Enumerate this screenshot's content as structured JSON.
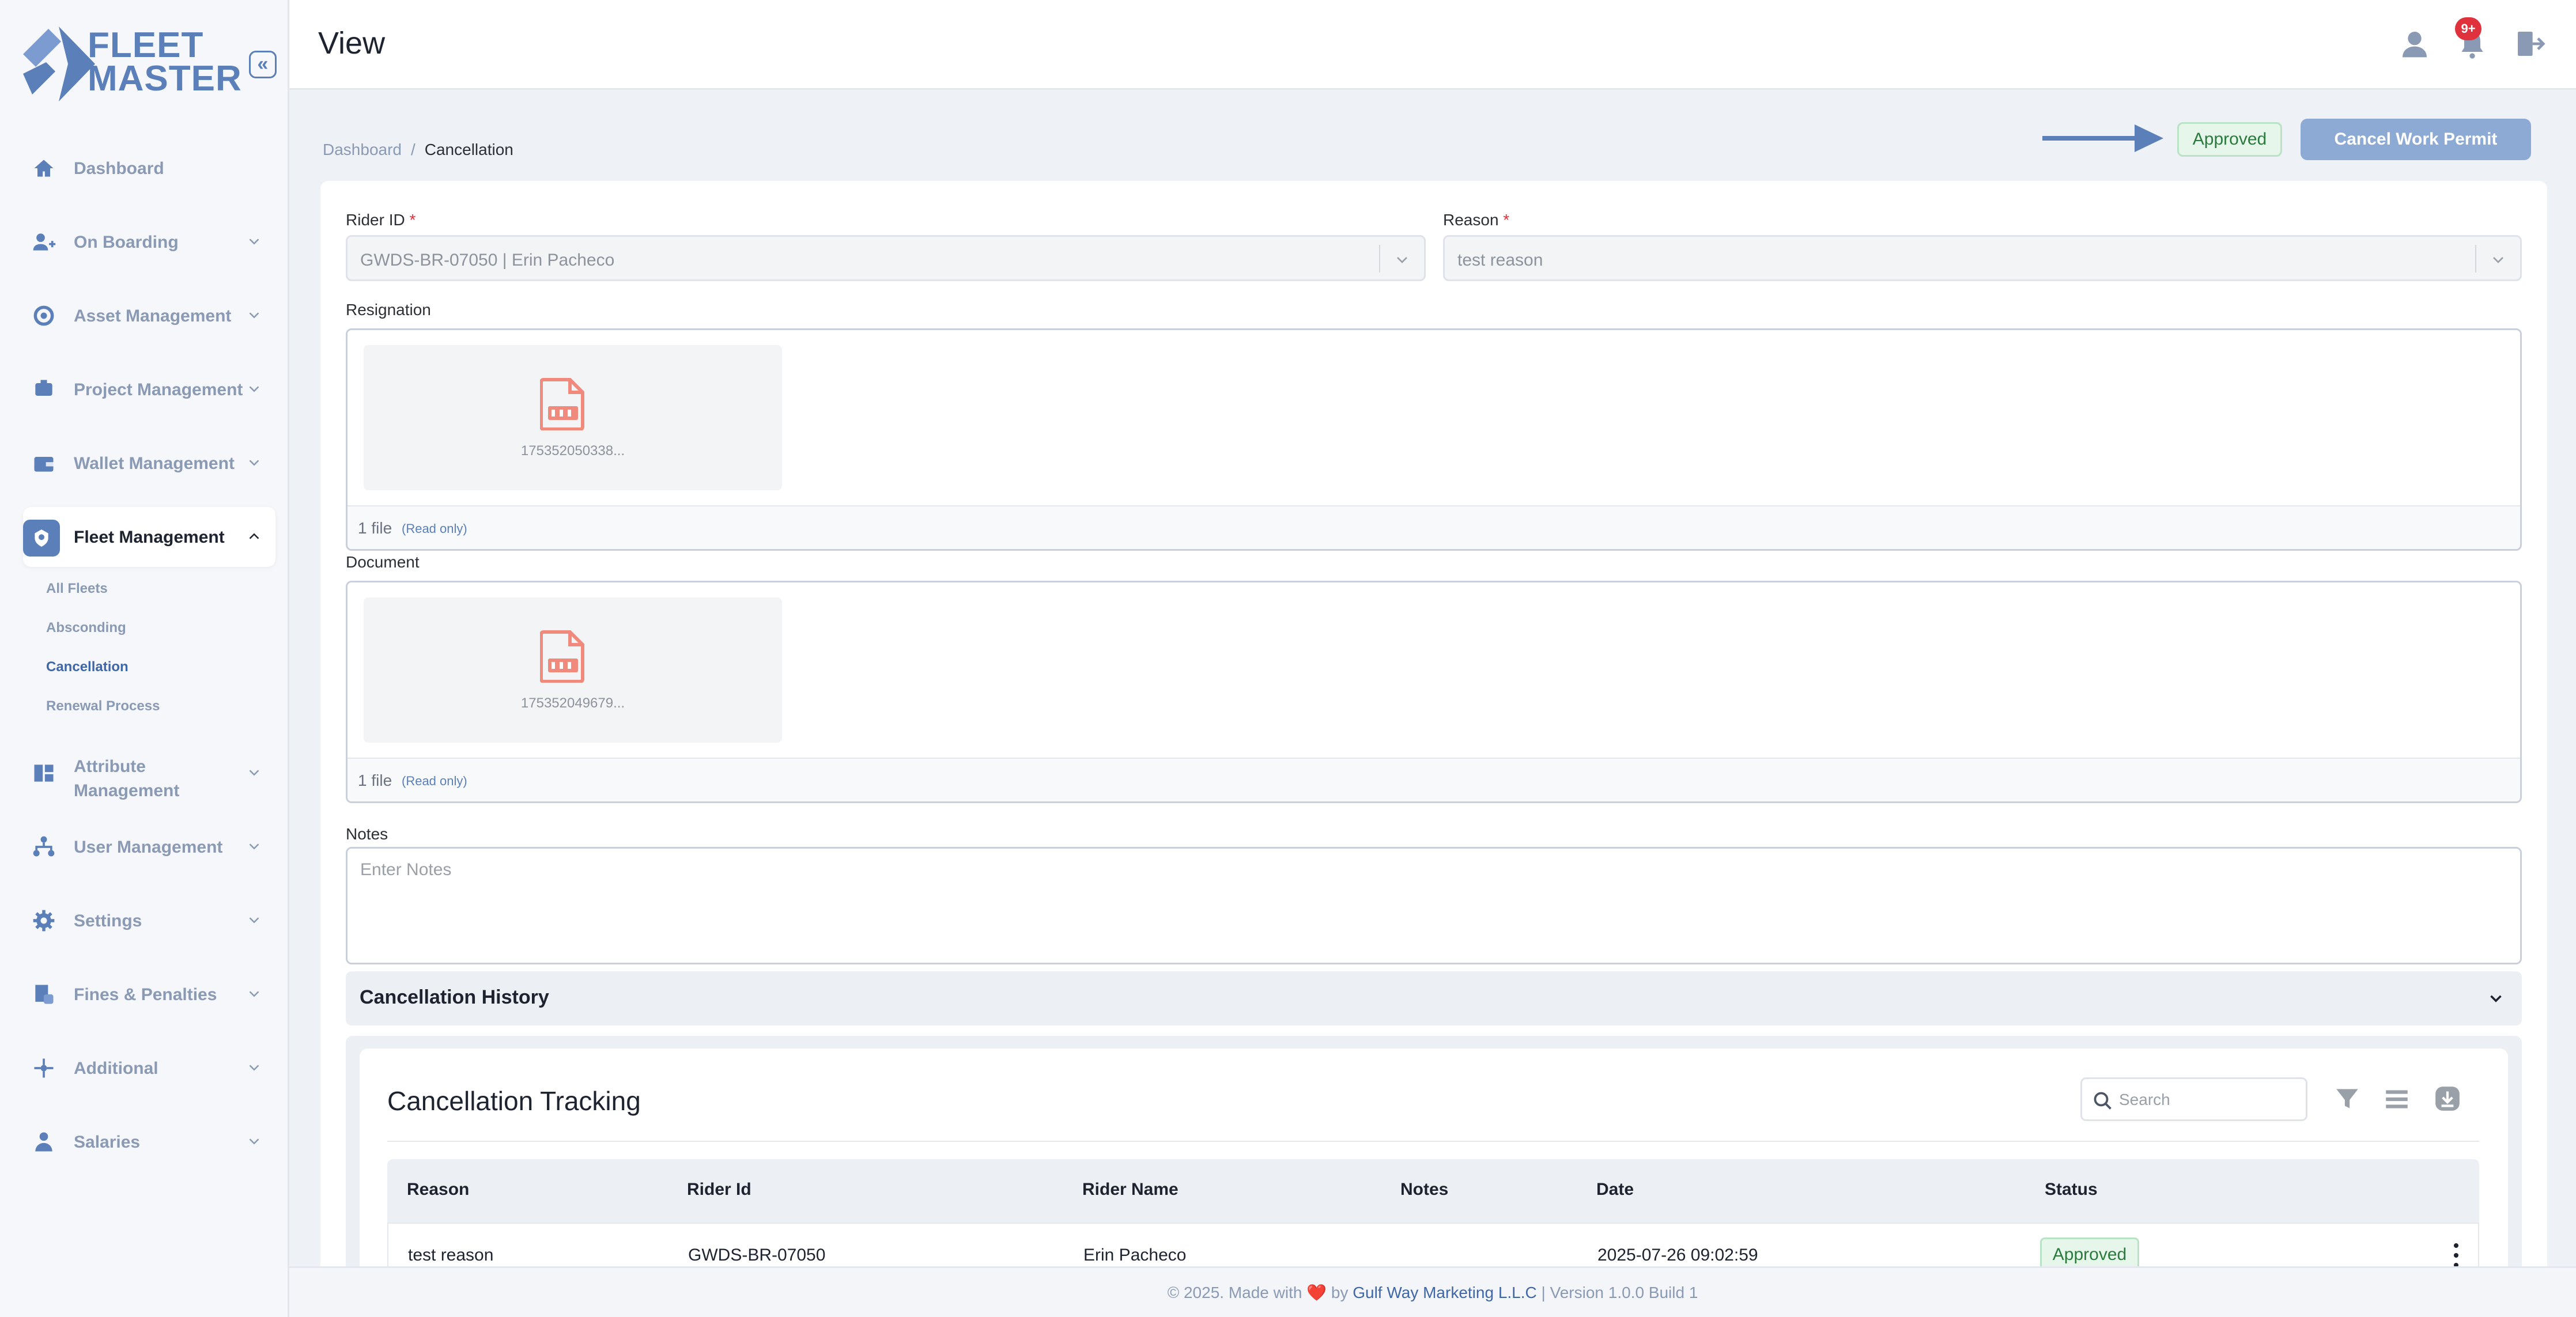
{
  "brand": {
    "name_line1": "FLEET",
    "name_line2": "MASTER",
    "collapse_glyph": "«",
    "accent_color": "#5b7fb9"
  },
  "sidebar": {
    "items": [
      {
        "label": "Dashboard",
        "icon": "home-icon",
        "has_chevron": false
      },
      {
        "label": "On Boarding",
        "icon": "user-plus-icon",
        "has_chevron": true
      },
      {
        "label": "Asset Management",
        "icon": "asset-icon",
        "has_chevron": true
      },
      {
        "label": "Project Management",
        "icon": "project-icon",
        "has_chevron": true
      },
      {
        "label": "Wallet Management",
        "icon": "wallet-icon",
        "has_chevron": true
      },
      {
        "label": "Fleet Management",
        "icon": "fleet-icon",
        "has_chevron": true,
        "active": true,
        "expanded": true
      },
      {
        "label": "Attribute Management",
        "icon": "attribute-icon",
        "has_chevron": true
      },
      {
        "label": "User Management",
        "icon": "org-icon",
        "has_chevron": true
      },
      {
        "label": "Settings",
        "icon": "gear-icon",
        "has_chevron": true
      },
      {
        "label": "Fines & Penalties",
        "icon": "fines-icon",
        "has_chevron": true
      },
      {
        "label": "Additional",
        "icon": "additional-icon",
        "has_chevron": true
      },
      {
        "label": "Salaries",
        "icon": "salaries-icon",
        "has_chevron": true
      }
    ],
    "fleet_sub_items": [
      {
        "label": "All Fleets",
        "active": false
      },
      {
        "label": "Absconding",
        "active": false
      },
      {
        "label": "Cancellation",
        "active": true
      },
      {
        "label": "Renewal Process",
        "active": false
      }
    ]
  },
  "header": {
    "title": "View",
    "notification_badge": "9+",
    "icons": [
      "user-icon",
      "bell-icon",
      "logout-icon"
    ]
  },
  "breadcrumb": {
    "root": "Dashboard",
    "separator": "/",
    "current": "Cancellation"
  },
  "actions": {
    "status_pill": "Approved",
    "cancel_button": "Cancel Work Permit"
  },
  "form": {
    "rider_id": {
      "label": "Rider ID",
      "required_mark": "*",
      "value": "GWDS-BR-07050 | Erin Pacheco"
    },
    "reason": {
      "label": "Reason",
      "required_mark": "*",
      "value": "test reason"
    },
    "resignation": {
      "label": "Resignation",
      "file_name": "175352050338...",
      "file_count": "1 file",
      "read_only": "(Read only)"
    },
    "document": {
      "label": "Document",
      "file_name": "175352049679...",
      "file_count": "1 file",
      "read_only": "(Read only)"
    },
    "notes": {
      "label": "Notes",
      "placeholder": "Enter Notes",
      "value": ""
    }
  },
  "history": {
    "title": "Cancellation History"
  },
  "tracking": {
    "title": "Cancellation Tracking",
    "search_placeholder": "Search",
    "tools": [
      "filter-icon",
      "columns-icon",
      "download-icon"
    ],
    "columns": [
      "Reason",
      "Rider Id",
      "Rider Name",
      "Notes",
      "Date",
      "Status"
    ],
    "rows": [
      {
        "reason": "test reason",
        "rider_id": "GWDS-BR-07050",
        "rider_name": "Erin Pacheco",
        "notes": "",
        "date": "2025-07-26 09:02:59",
        "status": "Approved"
      }
    ]
  },
  "footer": {
    "prefix": "© 2025. Made with",
    "heart": "❤️",
    "by": "by",
    "company": "Gulf Way Marketing L.L.C",
    "suffix": "| Version 1.0.0 Build 1"
  }
}
